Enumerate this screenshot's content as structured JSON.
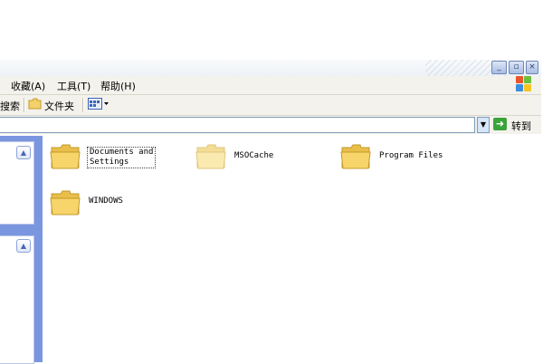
{
  "menu": {
    "items": [
      "收藏(A)",
      "工具(T)",
      "帮助(H)"
    ]
  },
  "toolbar": {
    "search_label": "搜索",
    "folders_label": "文件夹",
    "views_icon": "views-icon"
  },
  "address": {
    "value": "",
    "go_label": "转到"
  },
  "folders": [
    {
      "name": "Documents and\nSettings",
      "selected": true,
      "dimmed": false
    },
    {
      "name": "MSOCache",
      "selected": false,
      "dimmed": true
    },
    {
      "name": "Program Files",
      "selected": false,
      "dimmed": false
    },
    {
      "name": "WINDOWS",
      "selected": false,
      "dimmed": false
    }
  ],
  "colors": {
    "folder_fill": "#f7d56b",
    "folder_dimmed_fill": "#fbeab0",
    "taskpane_blue": "#7a96df",
    "go_green": "#3aa43a"
  }
}
